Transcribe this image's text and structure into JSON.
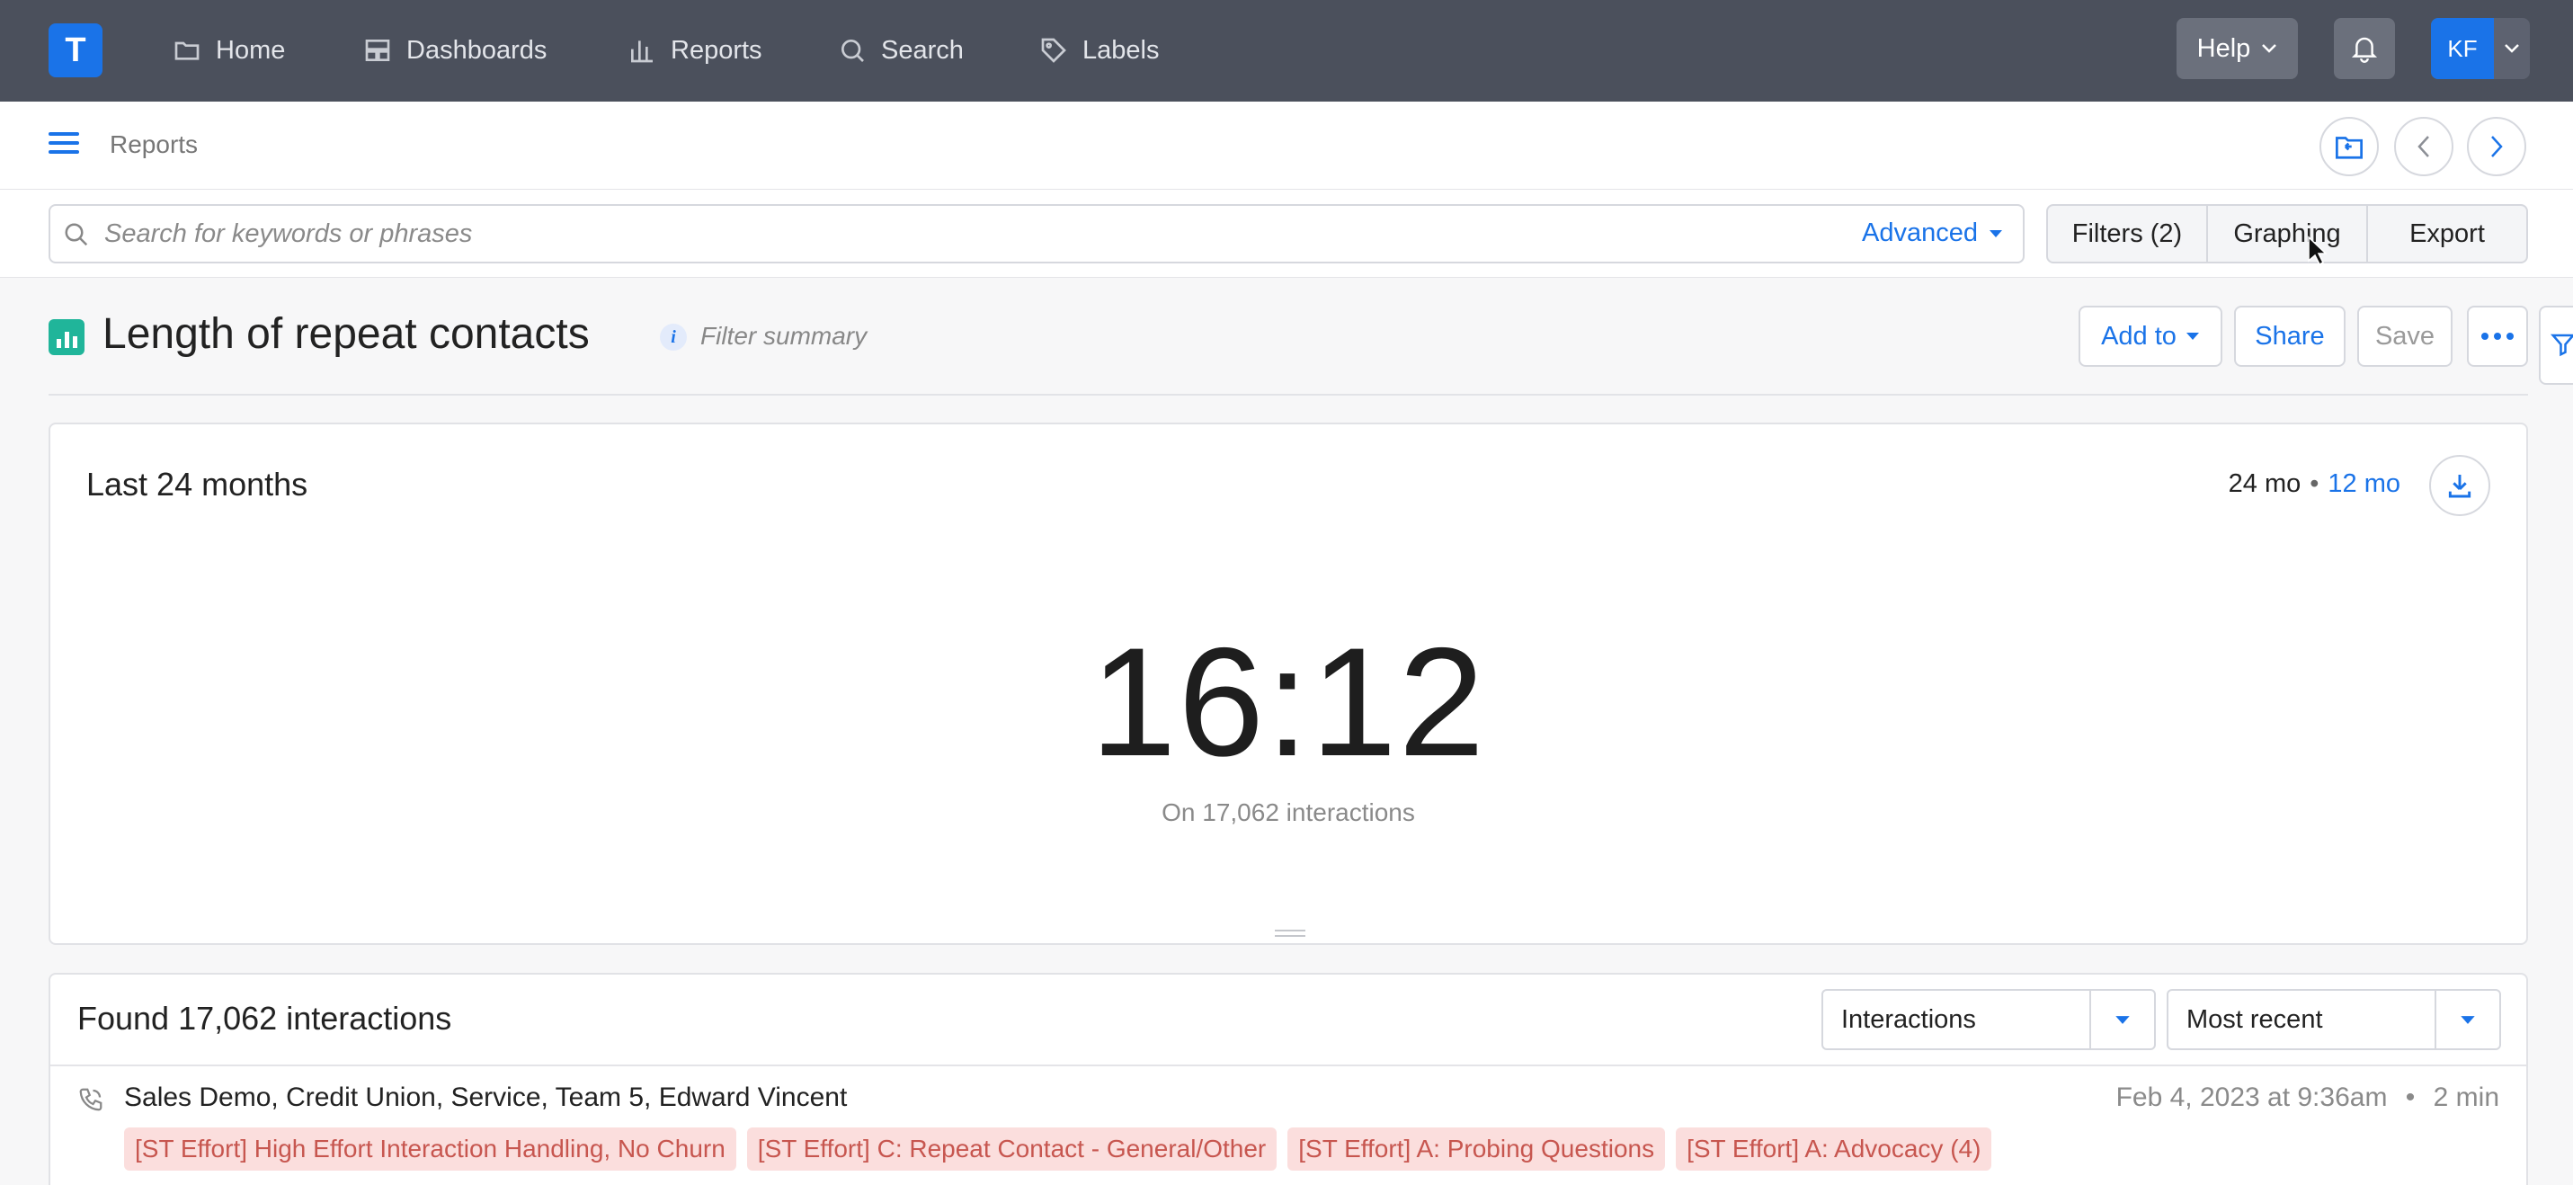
{
  "app": {
    "logo_letter": "T",
    "brand_color": "#1a73e8"
  },
  "topnav": {
    "items": [
      {
        "label": "Home",
        "icon": "folder-icon"
      },
      {
        "label": "Dashboards",
        "icon": "dashboard-icon"
      },
      {
        "label": "Reports",
        "icon": "bar-chart-icon"
      },
      {
        "label": "Search",
        "icon": "search-icon"
      },
      {
        "label": "Labels",
        "icon": "tag-icon"
      }
    ],
    "help_label": "Help",
    "avatar_initials": "KF"
  },
  "breadcrumb": {
    "label": "Reports"
  },
  "search": {
    "placeholder": "Search for keywords or phrases",
    "advanced_label": "Advanced",
    "filters_label": "Filters (2)",
    "graphing_label": "Graphing",
    "export_label": "Export"
  },
  "report": {
    "title": "Length of repeat contacts",
    "filter_summary_label": "Filter summary",
    "add_to_label": "Add to",
    "share_label": "Share",
    "save_label": "Save"
  },
  "metric_card": {
    "title": "Last 24 months",
    "range_active": "24 mo",
    "range_separator": "•",
    "range_alt": "12 mo",
    "value": "16:12",
    "subtitle": "On 17,062 interactions"
  },
  "results": {
    "heading": "Found 17,062 interactions",
    "view_select": "Interactions",
    "sort_select": "Most recent",
    "rows": [
      {
        "title": "Sales Demo, Credit Union, Service, Team 5, Edward Vincent",
        "date": "Feb 4, 2023 at 9:36am",
        "separator": "•",
        "duration": "2 min",
        "tags": [
          "[ST Effort] High Effort Interaction Handling, No Churn",
          "[ST Effort] C: Repeat Contact - General/Other",
          "[ST Effort] A: Probing Questions",
          "[ST Effort] A: Advocacy (4)"
        ]
      }
    ]
  },
  "colors": {
    "topnav_bg": "#4b505c",
    "accent": "#1a73e8",
    "report_icon": "#20b59a",
    "tag_bg": "#fbdedd",
    "tag_text": "#c7564f"
  }
}
